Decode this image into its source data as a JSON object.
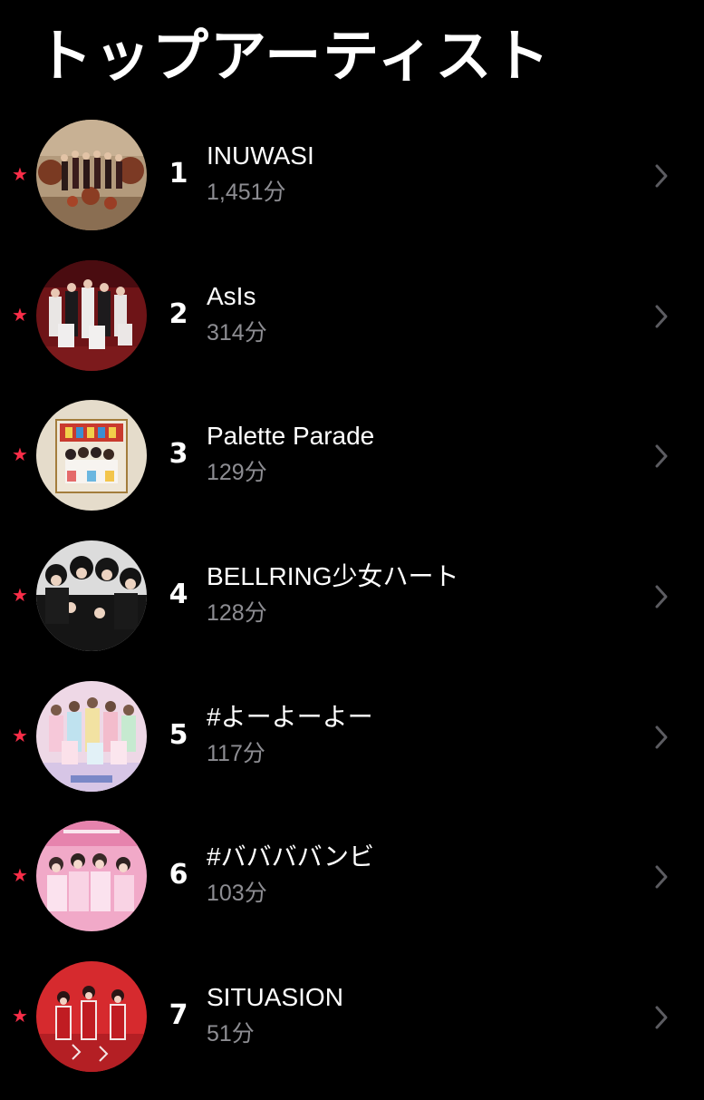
{
  "header": {
    "title": "トップアーティスト"
  },
  "colors": {
    "background": "#000000",
    "accent_star": "#fa2d48",
    "primary_text": "#ffffff",
    "secondary_text": "#8d8d92",
    "chevron": "#5c5c61"
  },
  "icons": {
    "star": "★",
    "chevron": "chevron-right-icon"
  },
  "artists": [
    {
      "rank": "1",
      "name": "INUWASI",
      "minutes": "1,451分",
      "favorite": true
    },
    {
      "rank": "2",
      "name": "AsIs",
      "minutes": "314分",
      "favorite": true
    },
    {
      "rank": "3",
      "name": "Palette Parade",
      "minutes": "129分",
      "favorite": true
    },
    {
      "rank": "4",
      "name": "BELLRING少女ハート",
      "minutes": "128分",
      "favorite": true
    },
    {
      "rank": "5",
      "name": "#よーよーよー",
      "minutes": "117分",
      "favorite": true
    },
    {
      "rank": "6",
      "name": "#ババババンビ",
      "minutes": "103分",
      "favorite": true
    },
    {
      "rank": "7",
      "name": "SITUASION",
      "minutes": "51分",
      "favorite": true
    }
  ]
}
